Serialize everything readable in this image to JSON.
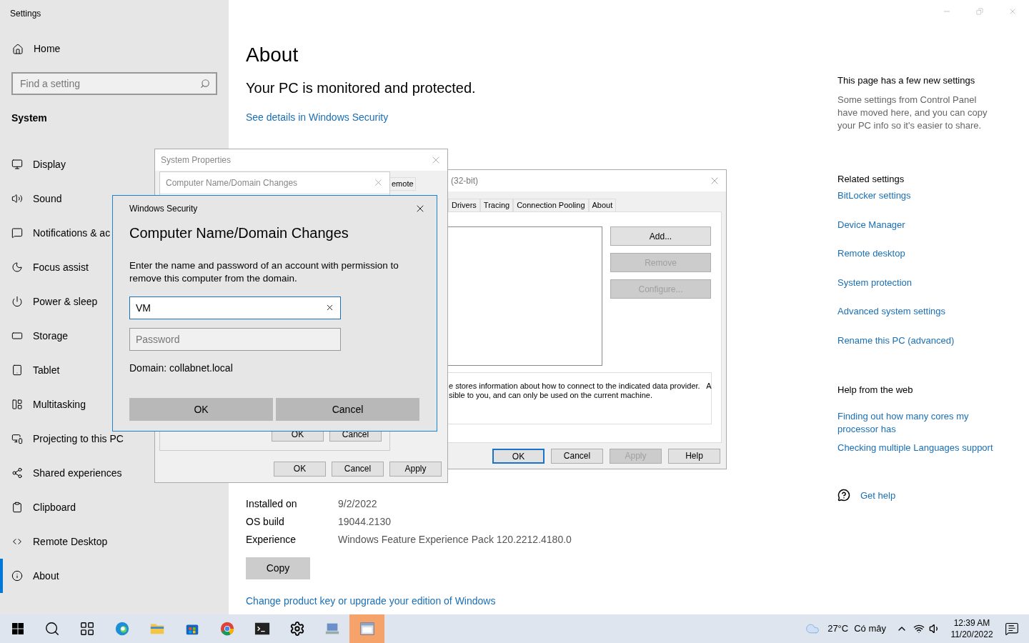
{
  "settings": {
    "title": "Settings",
    "home": "Home",
    "search": {
      "placeholder": "Find a setting"
    },
    "section": "System",
    "nav": [
      {
        "label": "Display",
        "selected": false
      },
      {
        "label": "Sound",
        "selected": false
      },
      {
        "label": "Notifications & ac",
        "selected": false
      },
      {
        "label": "Focus assist",
        "selected": false
      },
      {
        "label": "Power & sleep",
        "selected": false
      },
      {
        "label": "Storage",
        "selected": false
      },
      {
        "label": "Tablet",
        "selected": false
      },
      {
        "label": "Multitasking",
        "selected": false
      },
      {
        "label": "Projecting to this PC",
        "selected": false
      },
      {
        "label": "Shared experiences",
        "selected": false
      },
      {
        "label": "Clipboard",
        "selected": false
      },
      {
        "label": "Remote Desktop",
        "selected": false
      },
      {
        "label": "About",
        "selected": true
      }
    ]
  },
  "about": {
    "title": "About",
    "status": "Your PC is monitored and protected.",
    "security_link": "See details in Windows Security",
    "specs": [
      {
        "label": "Installed on",
        "value": "9/2/2022"
      },
      {
        "label": "OS build",
        "value": "19044.2130"
      },
      {
        "label": "Experience",
        "value": "Windows Feature Experience Pack 120.2212.4180.0"
      }
    ],
    "copy_button": "Copy",
    "product_key_link": "Change product key or upgrade your edition of Windows"
  },
  "right_panel": {
    "new_settings_title": "This page has a few new settings",
    "new_settings_text": "Some settings from Control Panel have moved here, and you can copy your PC info so it's easier to share.",
    "related_title": "Related settings",
    "related_links": [
      "BitLocker settings",
      "Device Manager",
      "Remote desktop",
      "System protection",
      "Advanced system settings",
      "Rename this PC (advanced)"
    ],
    "help_title": "Help from the web",
    "help_links": [
      "Finding out how many cores my processor has",
      "Checking multiple Languages support"
    ],
    "get_help": "Get help"
  },
  "system_properties": {
    "title": "System Properties",
    "child_title": "Computer Name/Domain Changes",
    "tab_fragment": "emote",
    "child_buttons": [
      "OK",
      "Cancel"
    ],
    "buttons": [
      "OK",
      "Cancel",
      "Apply"
    ]
  },
  "odbc": {
    "title": "(32-bit)",
    "tabs": [
      {
        "label": "Drivers",
        "selected": false
      },
      {
        "label": "Tracing",
        "selected": false
      },
      {
        "label": "Connection Pooling",
        "selected": false
      },
      {
        "label": "About",
        "selected": false
      }
    ],
    "side_buttons": [
      {
        "label": "Add...",
        "disabled": false
      },
      {
        "label": "Remove",
        "disabled": true
      },
      {
        "label": "Configure...",
        "disabled": true
      }
    ],
    "description": [
      "e stores information about how to connect to the indicated data provider.   A",
      "sible to you, and can only be used on the current machine."
    ],
    "buttons": [
      {
        "label": "OK",
        "disabled": false,
        "default": true
      },
      {
        "label": "Cancel",
        "disabled": false,
        "default": false
      },
      {
        "label": "Apply",
        "disabled": true,
        "default": false
      },
      {
        "label": "Help",
        "disabled": false,
        "default": false
      }
    ]
  },
  "security_dialog": {
    "title": "Windows Security",
    "heading": "Computer Name/Domain Changes",
    "text": "Enter the name and password of an account with permission to remove this computer from the domain.",
    "username": {
      "value": "VM"
    },
    "password": {
      "placeholder": "Password"
    },
    "domain": "Domain: collabnet.local",
    "buttons": [
      "OK",
      "Cancel"
    ]
  },
  "taskbar": {
    "apps": [
      {
        "selected": false
      },
      {
        "selected": false
      },
      {
        "selected": false
      },
      {
        "selected": false
      },
      {
        "selected": false
      },
      {
        "selected": false
      },
      {
        "selected": false
      },
      {
        "selected": false
      },
      {
        "selected": false
      },
      {
        "selected": true
      }
    ],
    "weather": "27°C",
    "weather_text": "Có mây",
    "time": "12:39 AM",
    "date": "11/20/2022"
  }
}
